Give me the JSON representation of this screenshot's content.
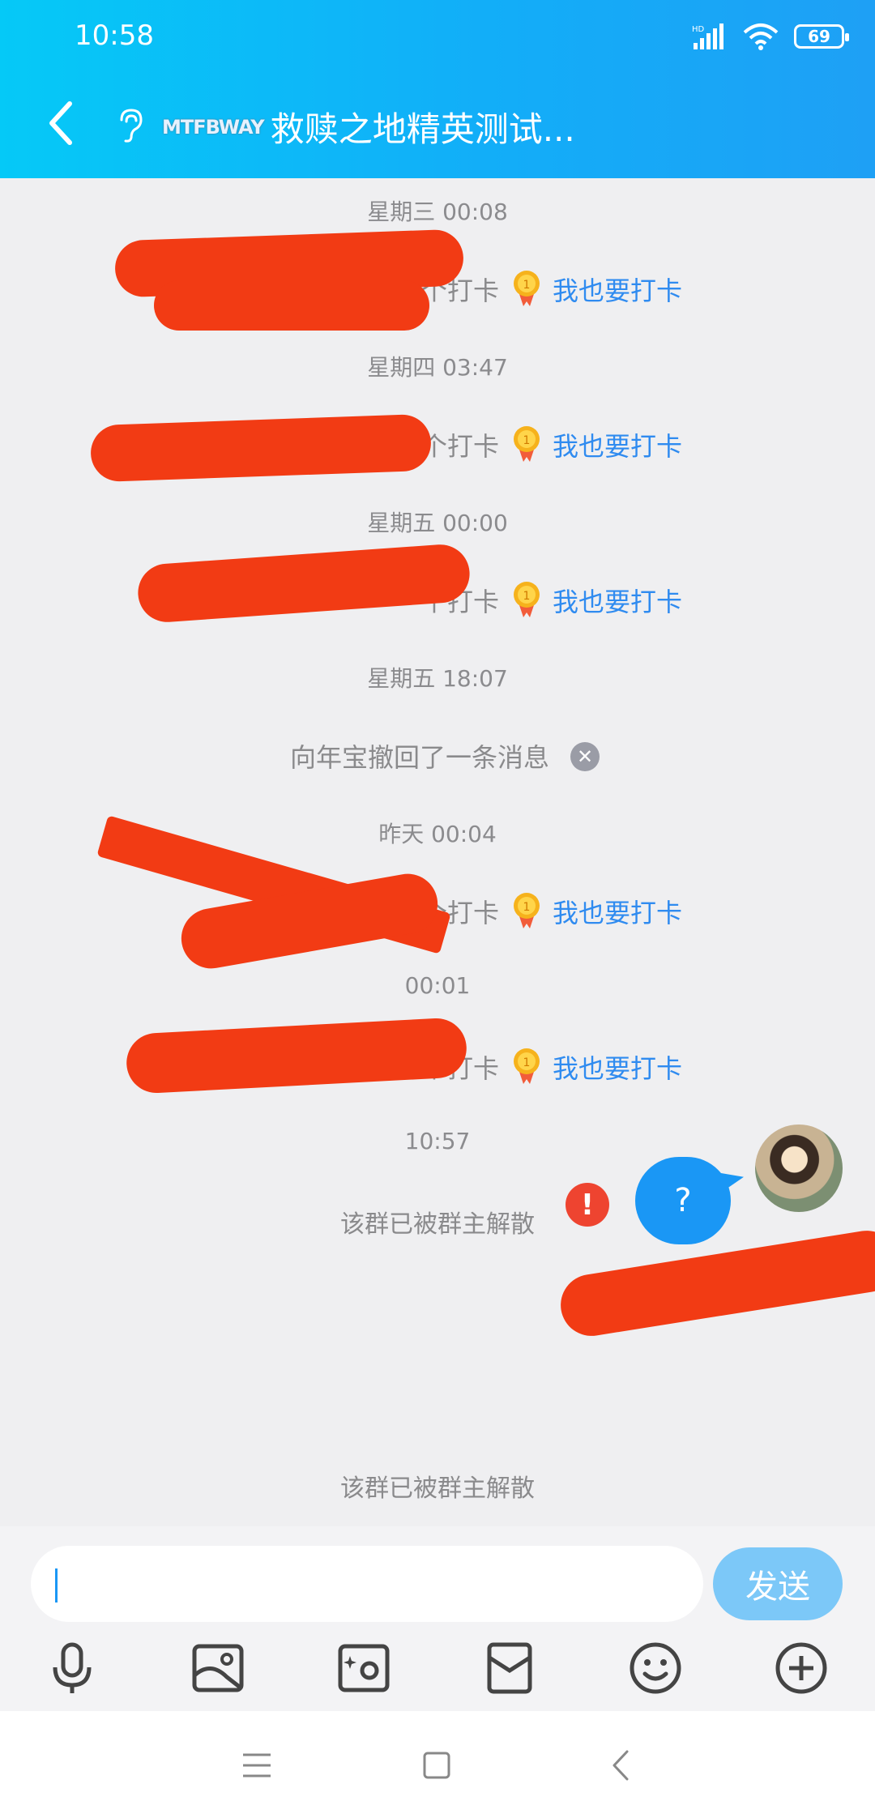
{
  "status_bar": {
    "time": "10:58",
    "network": "HD",
    "battery": "69"
  },
  "header": {
    "level_badge": "MTFBWAY",
    "title": "救赎之地精英测试..."
  },
  "messages": {
    "t1": "星期三 00:08",
    "checkin_suffix_1": "个打卡",
    "join_label": "我也要打卡",
    "t2": "星期四 03:47",
    "checkin_suffix_2": "个打卡",
    "t3": "星期五 00:00",
    "checkin_suffix_3": "个打卡",
    "t4": "星期五 18:07",
    "recall_text": "向年宝撤回了一条消息",
    "t5": "昨天 00:04",
    "checkin_suffix_4": "个打卡",
    "t6": "00:01",
    "checkin_suffix_5": "个打卡",
    "t7": "10:57",
    "system_1": "该群已被群主解散",
    "bubble_text": "?",
    "system_2": "该群已被群主解散"
  },
  "input": {
    "value": "",
    "send_label": "发送"
  },
  "colors": {
    "header_start": "#05c9f7",
    "header_end": "#1ea0f5",
    "link": "#2f8bf0",
    "bubble": "#1a97f5",
    "error": "#ee4430"
  },
  "icons": {
    "toolbar": [
      "microphone-icon",
      "image-icon",
      "camera-icon",
      "red-packet-icon",
      "emoji-icon",
      "plus-icon"
    ],
    "nav": [
      "menu-icon",
      "home-icon",
      "back-icon"
    ]
  }
}
